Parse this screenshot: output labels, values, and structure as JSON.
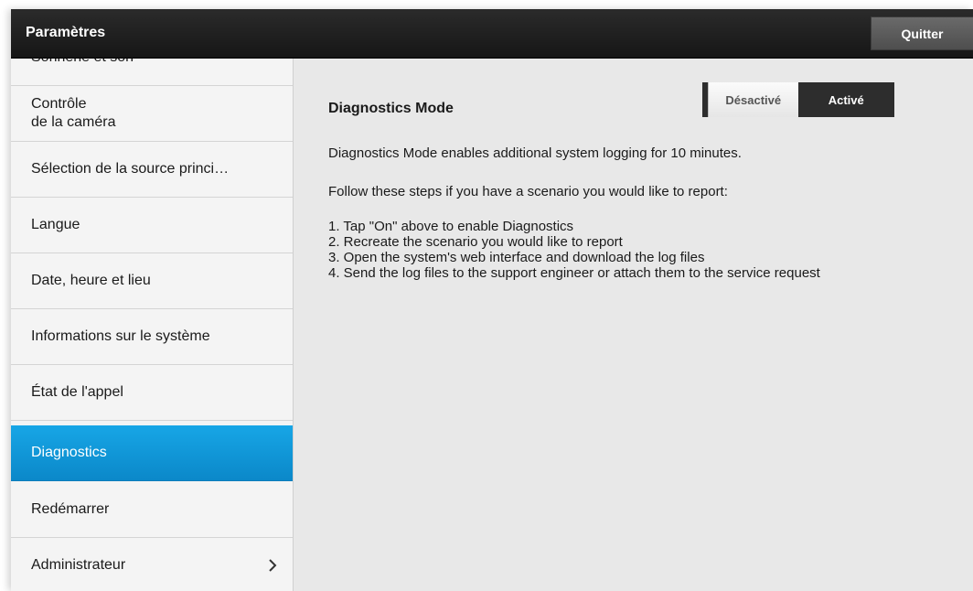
{
  "header": {
    "title": "Paramètres",
    "quit_label": "Quitter"
  },
  "sidebar": {
    "items": [
      {
        "label": "Sonnerie et son"
      },
      {
        "label": "Contrôle\nde la caméra"
      },
      {
        "label": "Sélection de la source princi…"
      },
      {
        "label": "Langue"
      },
      {
        "label": "Date, heure et lieu"
      },
      {
        "label": "Informations sur le système"
      },
      {
        "label": "État de l'appel"
      },
      {
        "label": "Diagnostics",
        "active": true
      },
      {
        "label": "Redémarrer"
      },
      {
        "label": "Administrateur",
        "icon": "chevron-right-icon"
      }
    ]
  },
  "main": {
    "title": "Diagnostics Mode",
    "toggle": {
      "off_label": "Désactivé",
      "on_label": "Activé",
      "selected": "Désactivé"
    },
    "description": "Diagnostics Mode enables additional system logging for 10 minutes.",
    "steps_intro": "Follow these steps if you have a scenario you would like to report:",
    "steps": [
      "1. Tap \"On\" above to enable Diagnostics",
      "2. Recreate the scenario you would like to report",
      "3. Open the system's web interface and download the log files",
      "4. Send the log files to the support engineer or attach them to the service request"
    ]
  },
  "colors": {
    "active_item": "#0b9ad8",
    "topbar": "#1c1c1c"
  }
}
